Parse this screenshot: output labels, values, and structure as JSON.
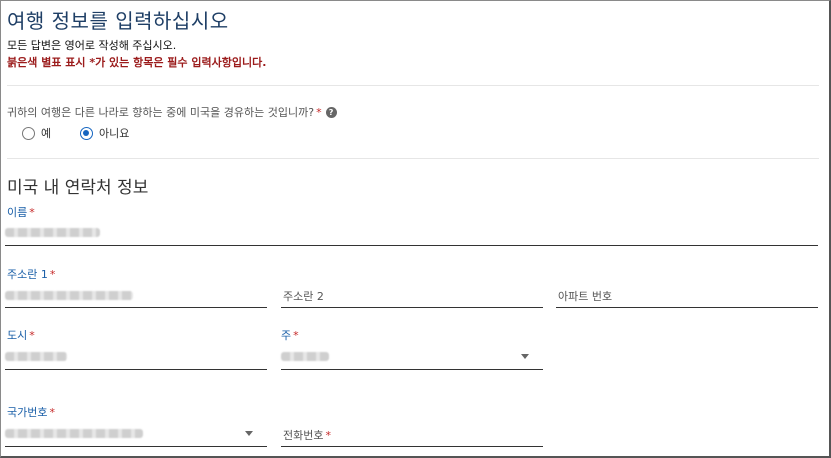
{
  "header": {
    "title": "여행 정보를 입력하십시오",
    "intro": "모든 답변은 영어로 작성해 주십시오.",
    "required_note": "붉은색 별표 표시 *가 있는 항목은 필수 입력사항입니다."
  },
  "transit_question": {
    "text": "귀하의 여행은 다른 나라로 향하는 중에 미국을 경유하는 것입니까?",
    "required_mark": "*",
    "help_icon": "?",
    "options": [
      {
        "label": "예",
        "selected": false
      },
      {
        "label": "아니요",
        "selected": true
      }
    ]
  },
  "contact_section": {
    "title": "미국 내 연락처 정보",
    "name_label": "이름",
    "address1_label": "주소란 1",
    "address2_label": "주소란 2",
    "apt_label": "아파트 번호",
    "city_label": "도시",
    "state_label": "주",
    "country_code_label": "국가번호",
    "phone_label": "전화번호",
    "required_mark": "*"
  },
  "colors": {
    "title": "#1f3f66",
    "required": "#c62828",
    "focus_label": "#1a5fa8",
    "radio_selected": "#1565c0"
  }
}
